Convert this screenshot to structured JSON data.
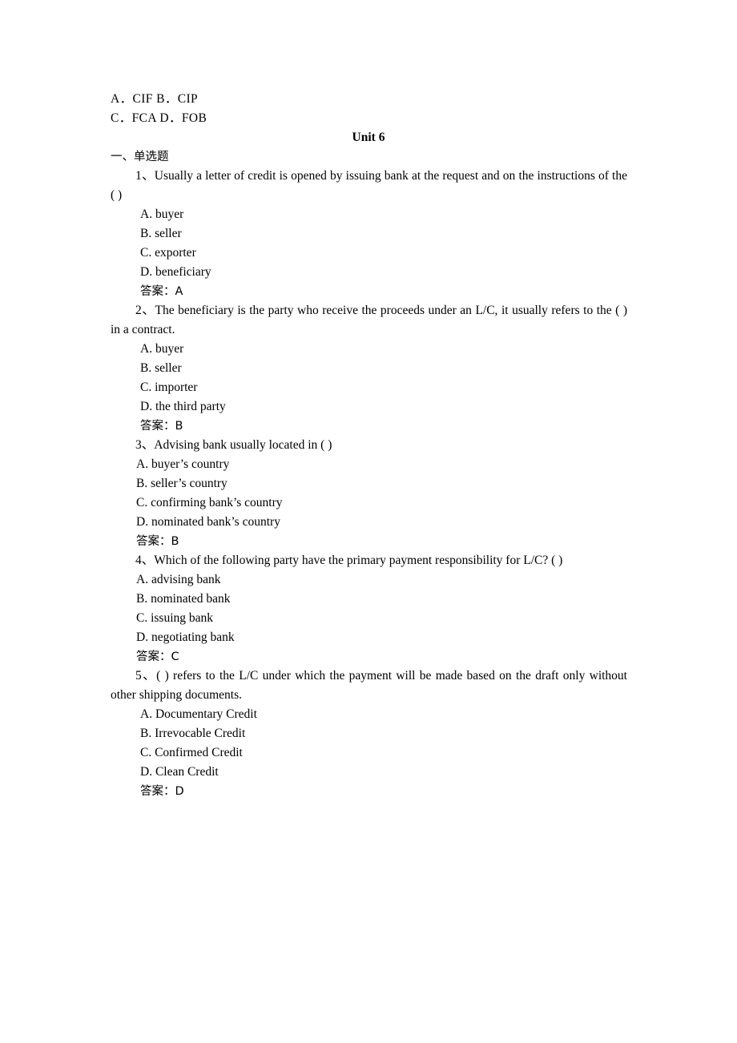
{
  "document": {
    "carryover_options": [
      "A．CIF B．CIP",
      "C．FCA D．FOB"
    ],
    "unit_heading": "Unit 6",
    "section_heading": "一、单选题",
    "answer_label": "答案：",
    "questions": [
      {
        "number": "1",
        "stem": "1、Usually a letter of credit is opened by issuing bank at the request and on the instructions of the ( )",
        "options": [
          "A. buyer",
          "B. seller",
          "C. exporter",
          "D. beneficiary"
        ],
        "answer": "A",
        "answer_line": "答案：A",
        "indent": "deep"
      },
      {
        "number": "2",
        "stem": "2、The beneficiary is the party who receive the proceeds under an L/C, it usually refers to the ( ) in a contract.",
        "options": [
          "A. buyer",
          "B. seller",
          "C. importer",
          "D. the third party"
        ],
        "answer": "B",
        "answer_line": "答案：B",
        "indent": "deep"
      },
      {
        "number": "3",
        "stem": "3、Advising bank usually located in ( )",
        "options": [
          "A. buyer’s country",
          "B. seller’s country",
          "C. confirming bank’s country",
          "D. nominated bank’s country"
        ],
        "answer": "B",
        "answer_line": "答案：B",
        "indent": "shallow"
      },
      {
        "number": "4",
        "stem": "4、Which of the following party have the primary payment responsibility for L/C? ( )",
        "options": [
          "A. advising bank",
          "B. nominated bank",
          "C. issuing bank",
          "D. negotiating bank"
        ],
        "answer": "C",
        "answer_line": "答案：C",
        "indent": "shallow"
      },
      {
        "number": "5",
        "stem": "5、( ) refers to the L/C under which the payment will be made based on the draft only without other shipping documents.",
        "options": [
          "A. Documentary Credit",
          "B. Irrevocable Credit",
          "C. Confirmed Credit",
          "D. Clean Credit"
        ],
        "answer": "D",
        "answer_line": "答案：D",
        "indent": "deep"
      }
    ]
  }
}
